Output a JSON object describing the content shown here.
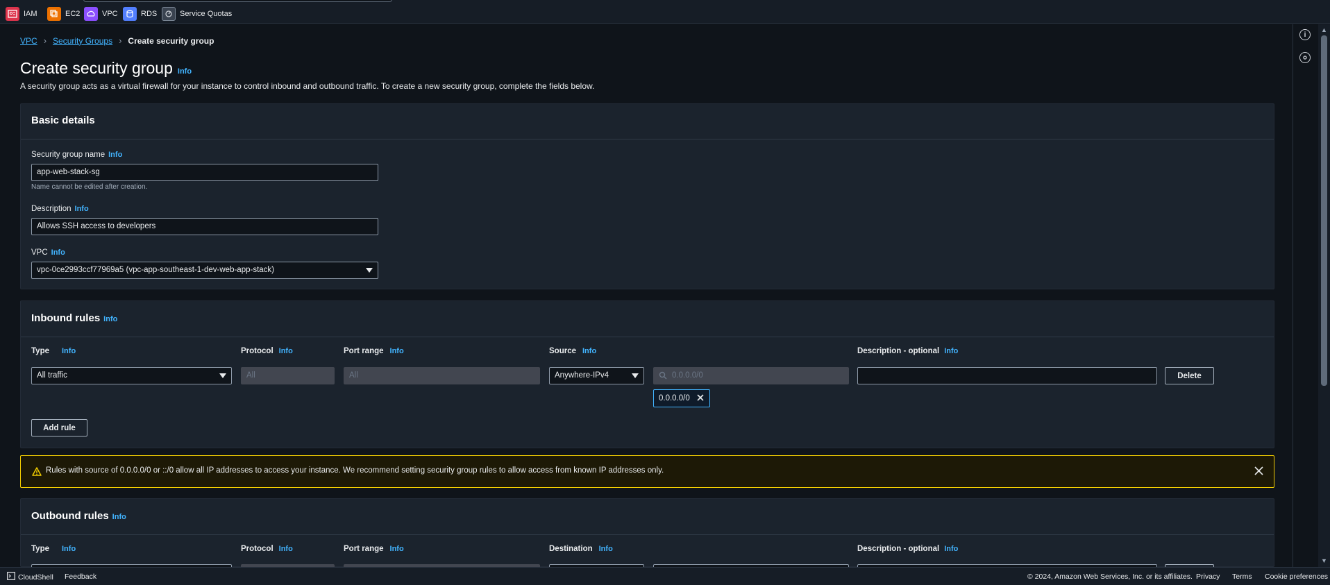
{
  "topbar": {
    "favorites": [
      {
        "label": "IAM",
        "icon": "iam-icon",
        "color": "#dd344c"
      },
      {
        "label": "EC2",
        "icon": "ec2-icon",
        "color": "#ed7100"
      },
      {
        "label": "VPC",
        "icon": "vpc-icon",
        "color": "#8c4fff"
      },
      {
        "label": "RDS",
        "icon": "rds-icon",
        "color": "#527fff"
      },
      {
        "label": "Service Quotas",
        "icon": "service-quotas-icon",
        "color": "#7d8998"
      }
    ]
  },
  "breadcrumb": {
    "items": [
      "VPC",
      "Security Groups"
    ],
    "current": "Create security group"
  },
  "page": {
    "title": "Create security group",
    "info": "Info",
    "description": "A security group acts as a virtual firewall for your instance to control inbound and outbound traffic. To create a new security group, complete the fields below."
  },
  "basic_details": {
    "heading": "Basic details",
    "name_label": "Security group name",
    "name_value": "app-web-stack-sg",
    "name_hint": "Name cannot be edited after creation.",
    "description_label": "Description",
    "description_value": "Allows SSH access to developers",
    "vpc_label": "VPC",
    "vpc_value": "vpc-0ce2993ccf77969a5 (vpc-app-southeast-1-dev-web-app-stack)"
  },
  "inbound": {
    "heading": "Inbound rules",
    "columns": {
      "type": "Type",
      "protocol": "Protocol",
      "port_range": "Port range",
      "source": "Source",
      "description": "Description - optional"
    },
    "row": {
      "type": "All traffic",
      "protocol": "All",
      "port_range": "All",
      "source": "Anywhere-IPv4",
      "cidr_placeholder": "0.0.0.0/0",
      "token": "0.0.0.0/0",
      "description": "",
      "delete": "Delete"
    },
    "add_rule": "Add rule"
  },
  "alert": {
    "color": "#f2cd00",
    "text": "Rules with source of 0.0.0.0/0 or ::/0 allow all IP addresses to access your instance. We recommend setting security group rules to allow access from known IP addresses only."
  },
  "outbound": {
    "heading": "Outbound rules",
    "columns": {
      "type": "Type",
      "protocol": "Protocol",
      "port_range": "Port range",
      "destination": "Destination",
      "description": "Description - optional"
    }
  },
  "footer": {
    "cloudshell": "CloudShell",
    "feedback": "Feedback",
    "copyright": "© 2024, Amazon Web Services, Inc. or its affiliates.",
    "privacy": "Privacy",
    "terms": "Terms",
    "cookie": "Cookie preferences"
  }
}
